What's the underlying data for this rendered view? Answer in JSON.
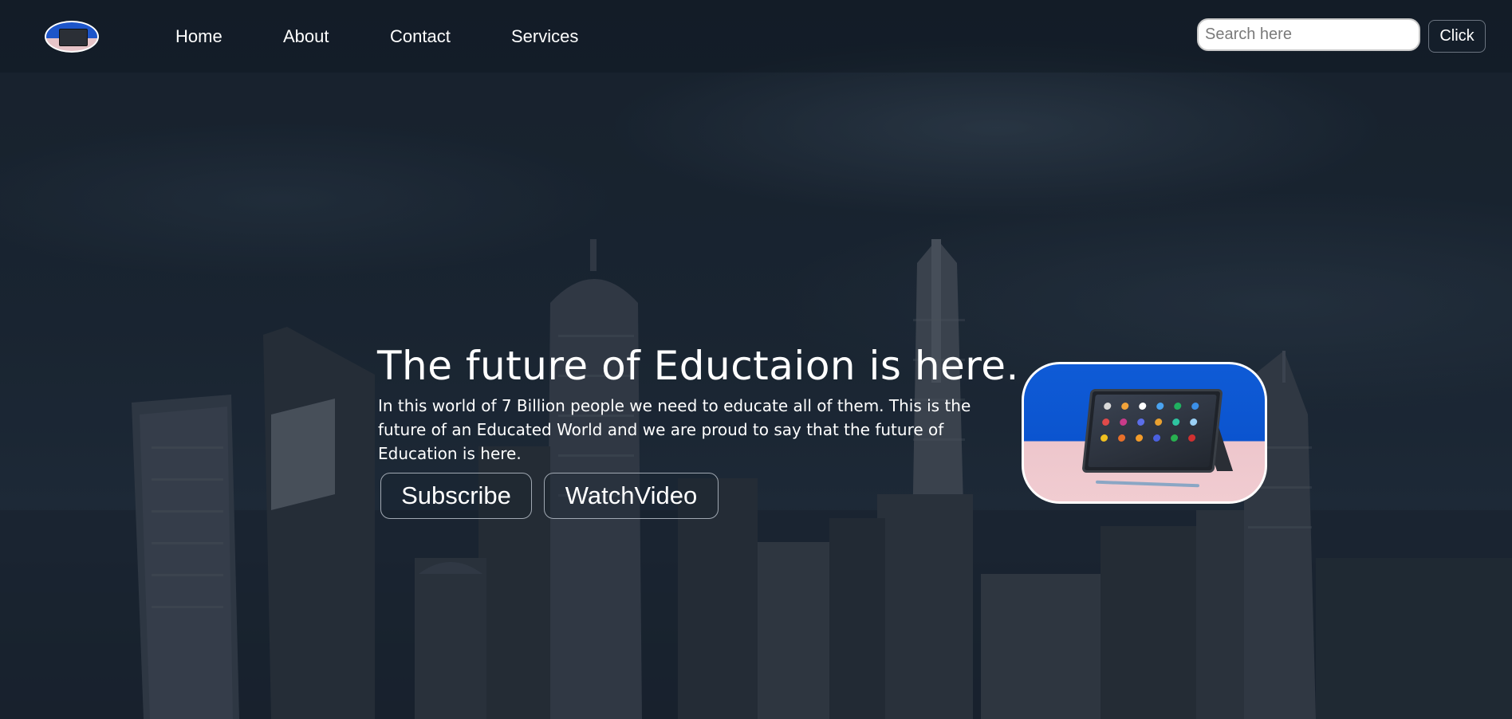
{
  "nav": {
    "items": [
      {
        "label": "Home"
      },
      {
        "label": "About"
      },
      {
        "label": "Contact"
      },
      {
        "label": "Services"
      }
    ],
    "search": {
      "placeholder": "Search here",
      "button_label": "Click"
    }
  },
  "hero": {
    "title": "The future of Eductaion is here.",
    "text": "In this world of 7 Billion people we need to educate all of them. This is the future of an Educated World and we are proud to say that the future of Education is here.",
    "buttons": {
      "subscribe": "Subscribe",
      "watch": "WatchVideo"
    }
  },
  "colors": {
    "text": "#ffffff",
    "background_overlay": "#16202c",
    "image_blue": "#0f5bd6",
    "image_pink": "#edc6cc"
  }
}
